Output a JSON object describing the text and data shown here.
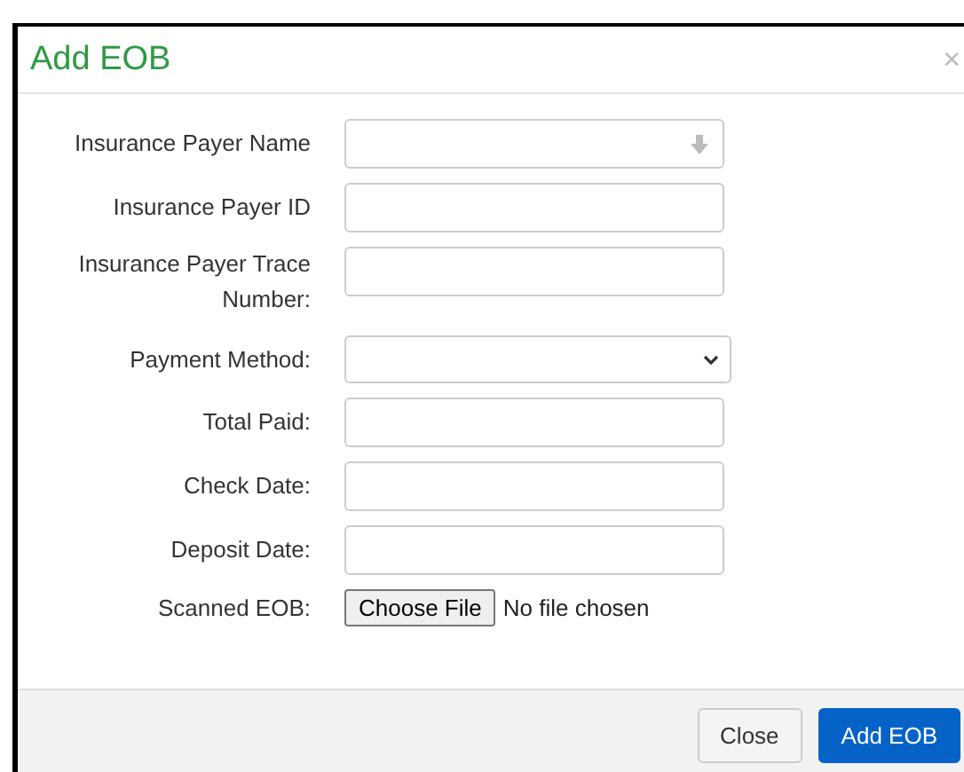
{
  "dialog": {
    "title": "Add EOB",
    "close_glyph": "×"
  },
  "fields": [
    {
      "label": "Insurance Payer Name",
      "kind": "combo"
    },
    {
      "label": "Insurance Payer ID",
      "kind": "text"
    },
    {
      "label": "Insurance Payer Trace Number:",
      "kind": "text"
    },
    {
      "label": "Payment Method:",
      "kind": "select"
    },
    {
      "label": "Total Paid:",
      "kind": "text"
    },
    {
      "label": "Check Date:",
      "kind": "text"
    },
    {
      "label": "Deposit Date:",
      "kind": "text"
    },
    {
      "label": "Scanned EOB:",
      "kind": "file",
      "button": "Choose File",
      "status": "No file chosen"
    }
  ],
  "buttons": [
    {
      "label": "Close",
      "kind": "default"
    },
    {
      "label": "Add EOB",
      "kind": "primary"
    }
  ]
}
